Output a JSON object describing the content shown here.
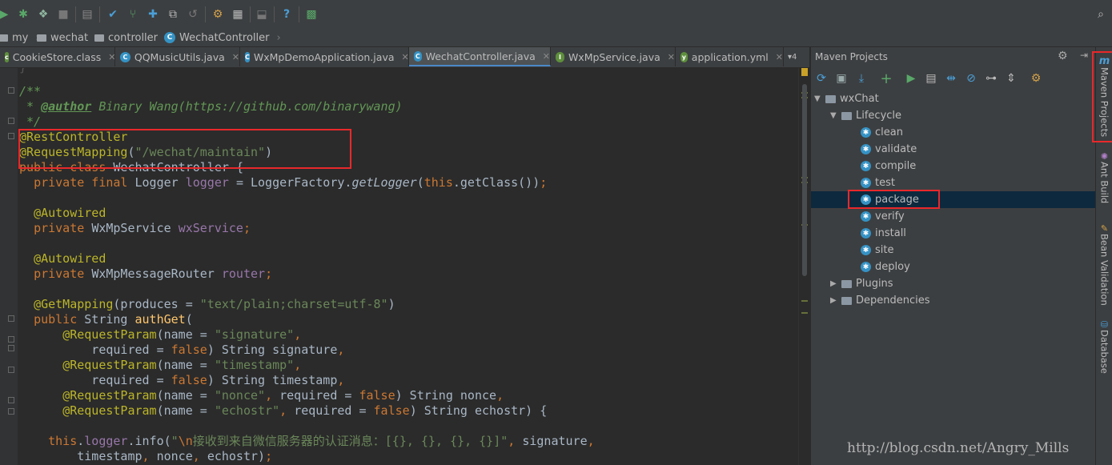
{
  "breadcrumb": {
    "items": [
      {
        "label": "my",
        "icon": "folder-icon"
      },
      {
        "label": "wechat",
        "icon": "folder-icon"
      },
      {
        "label": "controller",
        "icon": "folder-icon"
      },
      {
        "label": "WechatController",
        "icon": "class-icon"
      }
    ]
  },
  "tabs": [
    {
      "label": "CookieStore.class",
      "icon": "class-file-icon",
      "color": "#5e8f3c"
    },
    {
      "label": "QQMusicUtils.java",
      "icon": "class-icon",
      "color": "#3592c4"
    },
    {
      "label": "WxMpDemoApplication.java",
      "icon": "spring-boot-icon",
      "color": "#3592c4"
    },
    {
      "label": "WechatController.java",
      "icon": "class-icon",
      "color": "#3592c4",
      "active": true
    },
    {
      "label": "WxMpService.java",
      "icon": "interface-icon",
      "color": "#5e8f3c"
    },
    {
      "label": "application.yml",
      "icon": "yaml-icon",
      "color": "#5e8f3c"
    }
  ],
  "tabs_overflow": "▾4",
  "maven": {
    "title": "Maven Projects",
    "project": "wxChat",
    "lifecycle_label": "Lifecycle",
    "goals": [
      "clean",
      "validate",
      "compile",
      "test",
      "package",
      "verify",
      "install",
      "site",
      "deploy"
    ],
    "selected_goal": "package",
    "plugins_label": "Plugins",
    "dependencies_label": "Dependencies"
  },
  "side_tabs": [
    "Maven Projects",
    "Ant Build",
    "Bean Validation",
    "Database"
  ],
  "watermark": "http://blog.csdn.net/Angry_Mills",
  "colors": {
    "highlight_box": "#e8282b",
    "selection": "#0d293e",
    "accent": "#3592c4"
  }
}
